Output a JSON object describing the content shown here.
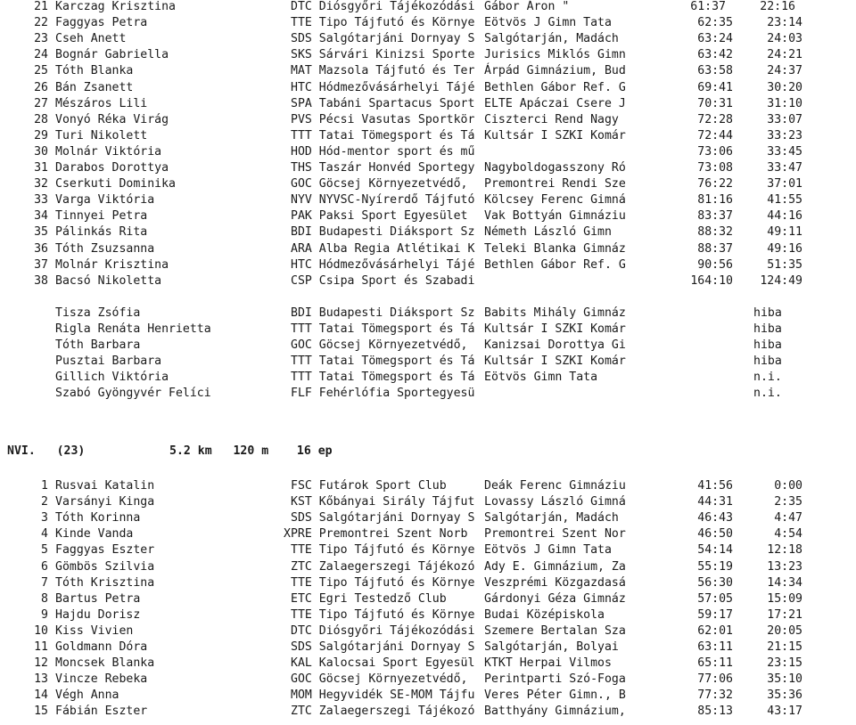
{
  "document": {
    "type": "orienteering-results-listing",
    "sections": [
      {
        "id": "section-continued",
        "header": null,
        "rows": [
          {
            "rank": "21",
            "name": "Karczag Krisztina",
            "club_code": "DTC",
            "club": "Diósgyőri Tájékozódási",
            "school": "Gábor Áron \"",
            "time": "61:37",
            "gap": "22:16",
            "status": null,
            "shift": "time-left-1"
          },
          {
            "rank": "22",
            "name": "Faggyas Petra",
            "club_code": "TTE",
            "club": "Tipo Tájfutó és Környe",
            "school": "Eötvös J Gimn Tata",
            "time": "62:35",
            "gap": "23:14",
            "status": null,
            "shift": null
          },
          {
            "rank": "23",
            "name": "Cseh Anett",
            "club_code": "SDS",
            "club": "Salgótarjáni Dornyay S",
            "school": "Salgótarján, Madách",
            "time": "63:24",
            "gap": "24:03",
            "status": null,
            "shift": null
          },
          {
            "rank": "24",
            "name": "Bognár Gabriella",
            "club_code": "SKS",
            "club": "Sárvári Kinizsi Sporte",
            "school": "Jurisics Miklós Gimn",
            "time": "63:42",
            "gap": "24:21",
            "status": null,
            "shift": null
          },
          {
            "rank": "25",
            "name": "Tóth Blanka",
            "club_code": "MAT",
            "club": "Mazsola Tájfutó és Ter",
            "school": "Árpád Gimnázium, Bud",
            "time": "63:58",
            "gap": "24:37",
            "status": null,
            "shift": null
          },
          {
            "rank": "26",
            "name": "Bán Zsanett",
            "club_code": "HTC",
            "club": "Hódmezővásárhelyi Tájé",
            "school": "Bethlen Gábor Ref. G",
            "time": "69:41",
            "gap": "30:20",
            "status": null,
            "shift": null
          },
          {
            "rank": "27",
            "name": "Mészáros Lili",
            "club_code": "SPA",
            "club": "Tabáni Spartacus Sport",
            "school": "ELTE Apáczai Csere J",
            "time": "70:31",
            "gap": "31:10",
            "status": null,
            "shift": null
          },
          {
            "rank": "28",
            "name": "Vonyó Réka Virág",
            "club_code": "PVS",
            "club": "Pécsi Vasutas Sportkör",
            "school": "Ciszterci Rend Nagy",
            "time": "72:28",
            "gap": "33:07",
            "status": null,
            "shift": null
          },
          {
            "rank": "29",
            "name": "Turi Nikolett",
            "club_code": "TTT",
            "club": "Tatai Tömegsport és Tá",
            "school": "Kultsár I SZKI Komár",
            "time": "72:44",
            "gap": "33:23",
            "status": null,
            "shift": null
          },
          {
            "rank": "30",
            "name": "Molnár Viktória",
            "club_code": "HOD",
            "club": "Hód-mentor sport és mű",
            "school": "",
            "time": "73:06",
            "gap": "33:45",
            "status": null,
            "shift": null
          },
          {
            "rank": "31",
            "name": "Darabos Dorottya",
            "club_code": "THS",
            "club": "Taszár Honvéd Sportegy",
            "school": "Nagyboldogasszony Ró",
            "time": "73:08",
            "gap": "33:47",
            "status": null,
            "shift": null
          },
          {
            "rank": "32",
            "name": "Cserkuti Dominika",
            "club_code": "GOC",
            "club": "Göcsej Környezetvédő,",
            "school": "Premontrei Rendi Sze",
            "time": "76:22",
            "gap": "37:01",
            "status": null,
            "shift": null
          },
          {
            "rank": "33",
            "name": "Varga Viktória",
            "club_code": "NYV",
            "club": "NYVSC-Nyírerdő Tájfutó",
            "school": "Kölcsey Ferenc Gimná",
            "time": "81:16",
            "gap": "41:55",
            "status": null,
            "shift": null
          },
          {
            "rank": "34",
            "name": "Tinnyei Petra",
            "club_code": "PAK",
            "club": "Paksi Sport Egyesület",
            "school": "Vak Bottyán Gimnáziu",
            "time": "83:37",
            "gap": "44:16",
            "status": null,
            "shift": null
          },
          {
            "rank": "35",
            "name": "Pálinkás Rita",
            "club_code": "BDI",
            "club": "Budapesti Diáksport Sz",
            "school": "Németh László Gimn",
            "time": "88:32",
            "gap": "49:11",
            "status": null,
            "shift": null
          },
          {
            "rank": "36",
            "name": "Tóth Zsuzsanna",
            "club_code": "ARA",
            "club": "Alba Regia Atlétikai K",
            "school": "Teleki Blanka Gimnáz",
            "time": "88:37",
            "gap": "49:16",
            "status": null,
            "shift": null
          },
          {
            "rank": "37",
            "name": "Molnár Krisztina",
            "club_code": "HTC",
            "club": "Hódmezővásárhelyi Tájé",
            "school": "Bethlen Gábor Ref. G",
            "time": "90:56",
            "gap": "51:35",
            "status": null,
            "shift": null
          },
          {
            "rank": "38",
            "name": "Bacsó Nikoletta",
            "club_code": "CSP",
            "club": "Csipa Sport és Szabadi",
            "school": "",
            "time": "164:10",
            "gap": "124:49",
            "status": null,
            "shift": null
          }
        ],
        "non_finishers": [
          {
            "rank": "",
            "name": "Tisza Zsófia",
            "club_code": "BDI",
            "club": "Budapesti Diáksport Sz",
            "school": "Babits Mihály Gimnáz",
            "time": null,
            "gap": null,
            "status": "hiba"
          },
          {
            "rank": "",
            "name": "Rigla Renáta Henrietta",
            "club_code": "TTT",
            "club": "Tatai Tömegsport és Tá",
            "school": "Kultsár I SZKI Komár",
            "time": null,
            "gap": null,
            "status": "hiba"
          },
          {
            "rank": "",
            "name": "Tóth Barbara",
            "club_code": "GOC",
            "club": "Göcsej Környezetvédő,",
            "school": "Kanizsai Dorottya Gi",
            "time": null,
            "gap": null,
            "status": "hiba"
          },
          {
            "rank": "",
            "name": "Pusztai Barbara",
            "club_code": "TTT",
            "club": "Tatai Tömegsport és Tá",
            "school": "Kultsár I SZKI Komár",
            "time": null,
            "gap": null,
            "status": "hiba"
          },
          {
            "rank": "",
            "name": "Gillich Viktória",
            "club_code": "TTT",
            "club": "Tatai Tömegsport és Tá",
            "school": "Eötvös Gimn Tata",
            "time": null,
            "gap": null,
            "status": "n.i."
          },
          {
            "rank": "",
            "name": "Szabó Gyöngyvér Felíci",
            "club_code": "FLF",
            "club": "Fehérlófia Sportegyesü",
            "school": "",
            "time": null,
            "gap": null,
            "status": "n.i."
          }
        ]
      },
      {
        "id": "section-nvi",
        "header": {
          "course": "NVI.   (23)",
          "course_name": "NVI.",
          "entrants": "(23)",
          "length": "5.2 km   120 m    16 ep",
          "distance": "5.2 km",
          "climb": "120 m",
          "controls": "16 ep"
        },
        "rows": [
          {
            "rank": "1",
            "name": "Rusvai Katalin",
            "club_code": "FSC",
            "club": "Futárok Sport Club",
            "school": "Deák Ferenc Gimnáziu",
            "time": "41:56",
            "gap": "0:00",
            "status": null,
            "shift": null
          },
          {
            "rank": "2",
            "name": "Varsányi Kinga",
            "club_code": "KST",
            "club": "Kőbányai Sirály Tájfut",
            "school": "Lovassy László Gimná",
            "time": "44:31",
            "gap": "2:35",
            "status": null,
            "shift": null
          },
          {
            "rank": "3",
            "name": "Tóth Korinna",
            "club_code": "SDS",
            "club": "Salgótarjáni Dornyay S",
            "school": "Salgótarján, Madách",
            "time": "46:43",
            "gap": "4:47",
            "status": null,
            "shift": null
          },
          {
            "rank": "4",
            "name": "Kinde Vanda",
            "club_code": "XPRE",
            "club": "Premontrei Szent Norb",
            "school": "Premontrei Szent Nor",
            "time": "46:50",
            "gap": "4:54",
            "status": null,
            "shift": "club-left-1"
          },
          {
            "rank": "5",
            "name": "Faggyas Eszter",
            "club_code": "TTE",
            "club": "Tipo Tájfutó és Környe",
            "school": "Eötvös J Gimn Tata",
            "time": "54:14",
            "gap": "12:18",
            "status": null,
            "shift": null
          },
          {
            "rank": "6",
            "name": "Gömbös Szilvia",
            "club_code": "ZTC",
            "club": "Zalaegerszegi Tájékozó",
            "school": "Ady E. Gimnázium, Za",
            "time": "55:19",
            "gap": "13:23",
            "status": null,
            "shift": null
          },
          {
            "rank": "7",
            "name": "Tóth Krisztina",
            "club_code": "TTE",
            "club": "Tipo Tájfutó és Környe",
            "school": "Veszprémi Közgazdasá",
            "time": "56:30",
            "gap": "14:34",
            "status": null,
            "shift": null
          },
          {
            "rank": "8",
            "name": "Bartus Petra",
            "club_code": "ETC",
            "club": "Egri Testedző Club",
            "school": "Gárdonyi Géza Gimnáz",
            "time": "57:05",
            "gap": "15:09",
            "status": null,
            "shift": null
          },
          {
            "rank": "9",
            "name": "Hajdu Dorisz",
            "club_code": "TTE",
            "club": "Tipo Tájfutó és Környe",
            "school": "Budai Középiskola",
            "time": "59:17",
            "gap": "17:21",
            "status": null,
            "shift": null
          },
          {
            "rank": "10",
            "name": "Kiss Vivien",
            "club_code": "DTC",
            "club": "Diósgyőri Tájékozódási",
            "school": "Szemere Bertalan Sza",
            "time": "62:01",
            "gap": "20:05",
            "status": null,
            "shift": null
          },
          {
            "rank": "11",
            "name": "Goldmann Dóra",
            "club_code": "SDS",
            "club": "Salgótarjáni Dornyay S",
            "school": "Salgótarján, Bolyai",
            "time": "63:11",
            "gap": "21:15",
            "status": null,
            "shift": null
          },
          {
            "rank": "12",
            "name": "Moncsek Blanka",
            "club_code": "KAL",
            "club": "Kalocsai Sport Egyesül",
            "school": "KTKT Herpai Vilmos",
            "time": "65:11",
            "gap": "23:15",
            "status": null,
            "shift": null
          },
          {
            "rank": "13",
            "name": "Vincze Rebeka",
            "club_code": "GOC",
            "club": "Göcsej Környezetvédő,",
            "school": "Perintparti Szó-Foga",
            "time": "77:06",
            "gap": "35:10",
            "status": null,
            "shift": null
          },
          {
            "rank": "14",
            "name": "Végh Anna",
            "club_code": "MOM",
            "club": "Hegyvidék SE-MOM Tájfu",
            "school": "Veres Péter Gimn., B",
            "time": "77:32",
            "gap": "35:36",
            "status": null,
            "shift": null
          },
          {
            "rank": "15",
            "name": "Fábián Eszter",
            "club_code": "ZTC",
            "club": "Zalaegerszegi Tájékozó",
            "school": "Batthyány Gimnázium,",
            "time": "85:13",
            "gap": "43:17",
            "status": null,
            "shift": null
          }
        ],
        "non_finishers": []
      }
    ]
  }
}
